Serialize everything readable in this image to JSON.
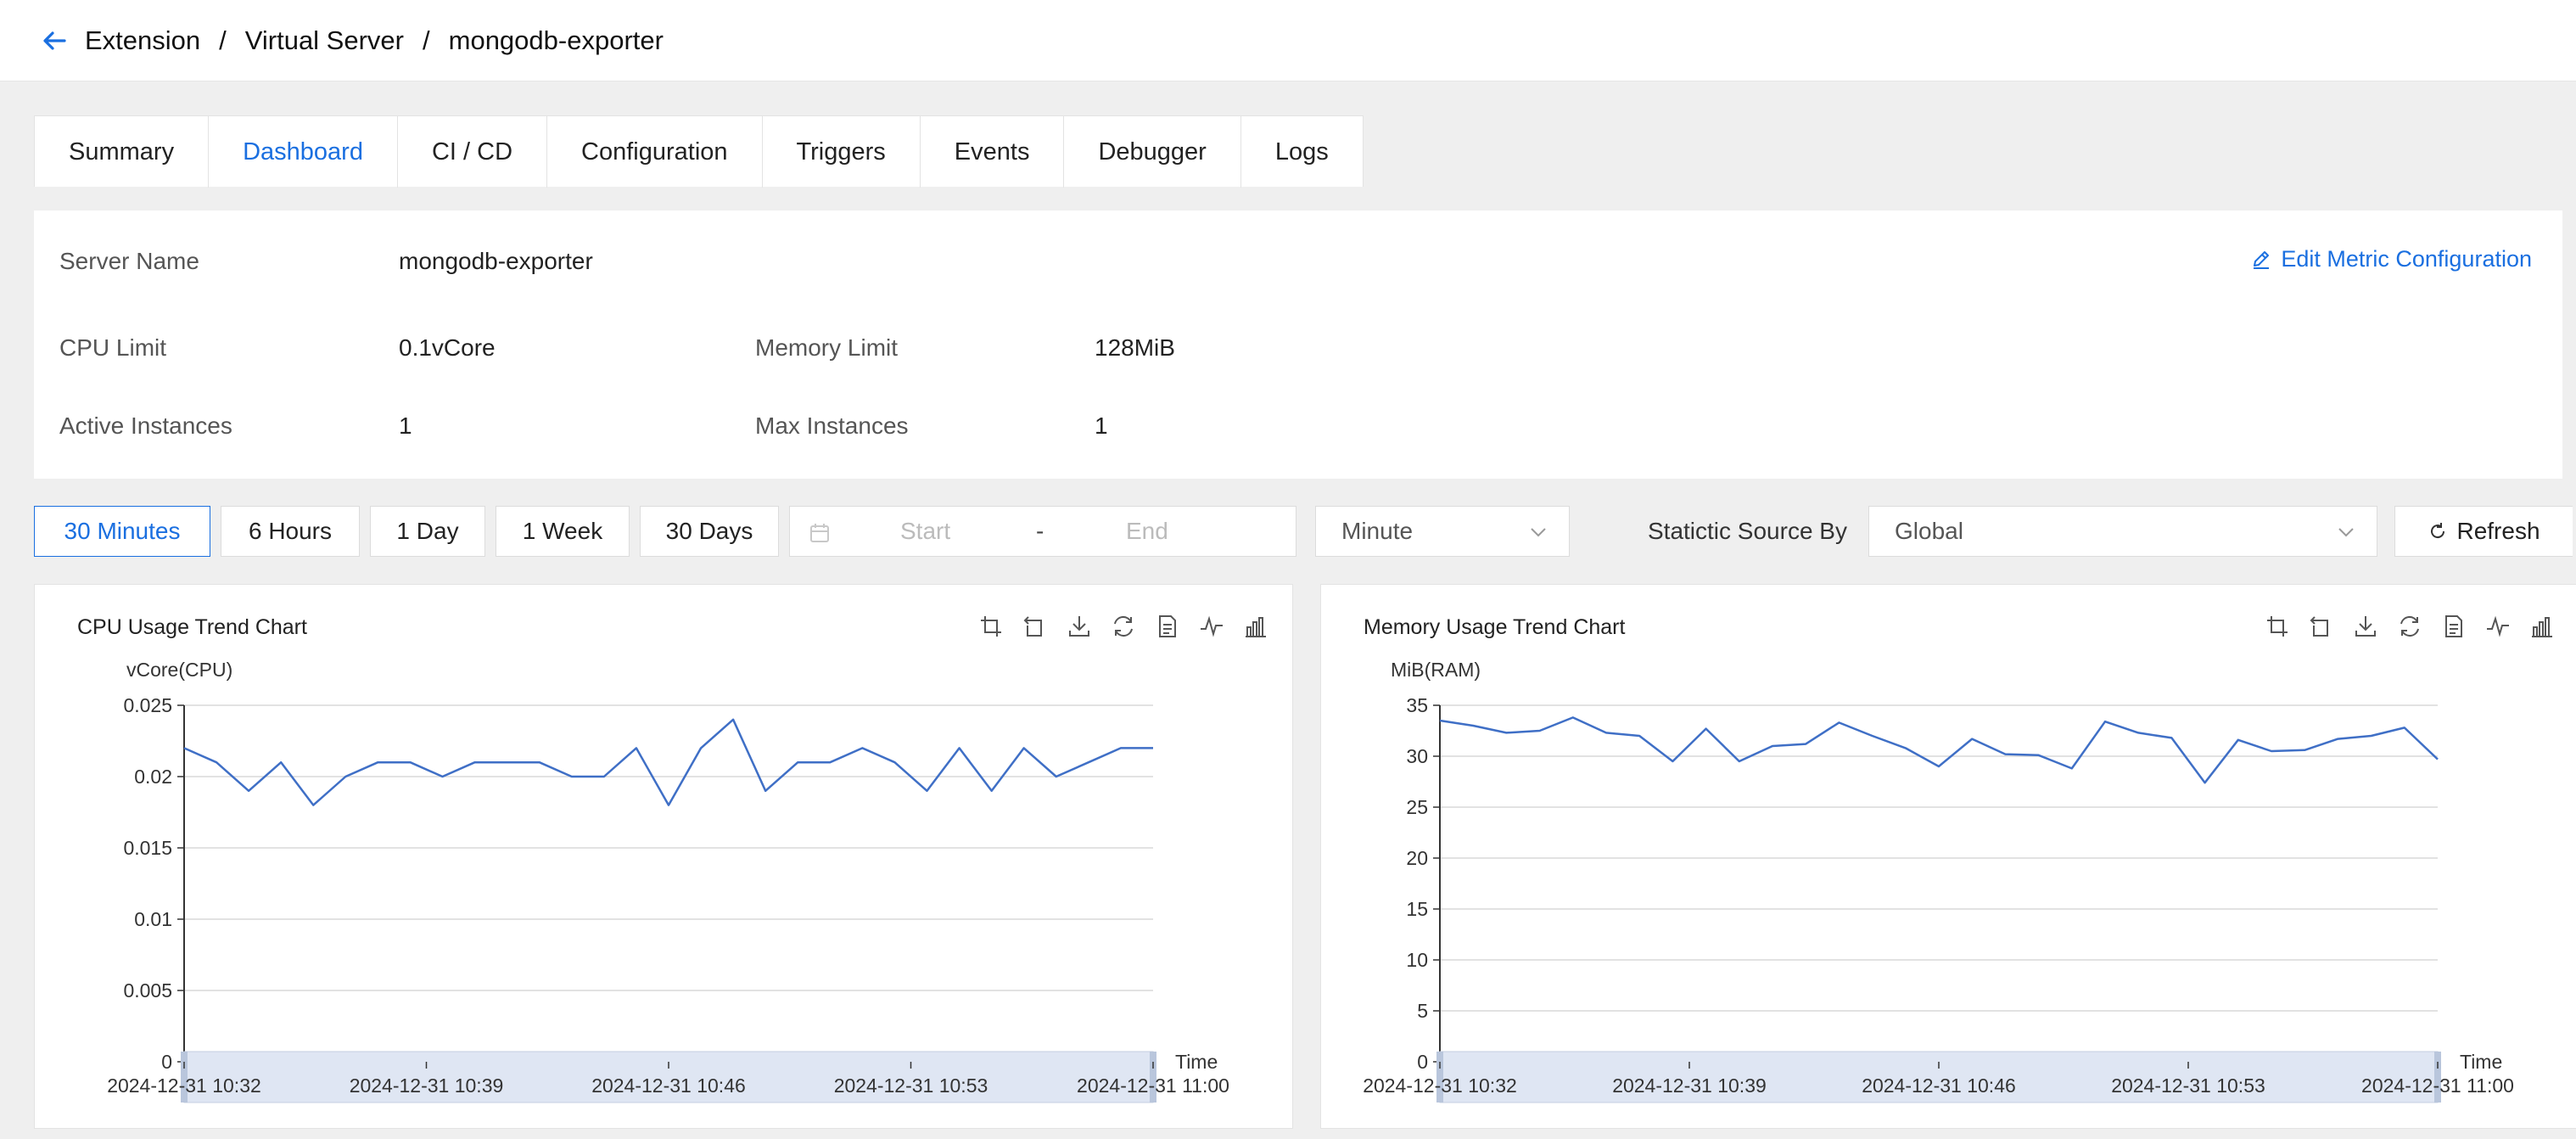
{
  "breadcrumb": {
    "items": [
      "Extension",
      "Virtual Server",
      "mongodb-exporter"
    ],
    "separator": "/"
  },
  "tabs": [
    {
      "label": "Summary",
      "active": false
    },
    {
      "label": "Dashboard",
      "active": true
    },
    {
      "label": "CI / CD",
      "active": false
    },
    {
      "label": "Configuration",
      "active": false
    },
    {
      "label": "Triggers",
      "active": false
    },
    {
      "label": "Events",
      "active": false
    },
    {
      "label": "Debugger",
      "active": false
    },
    {
      "label": "Logs",
      "active": false
    }
  ],
  "summary": {
    "server_name_label": "Server Name",
    "server_name_value": "mongodb-exporter",
    "cpu_limit_label": "CPU Limit",
    "cpu_limit_value": "0.1vCore",
    "memory_limit_label": "Memory Limit",
    "memory_limit_value": "128MiB",
    "active_instances_label": "Active Instances",
    "active_instances_value": "1",
    "max_instances_label": "Max Instances",
    "max_instances_value": "1",
    "edit_link": "Edit Metric Configuration"
  },
  "toolbar": {
    "ranges": [
      "30 Minutes",
      "6 Hours",
      "1 Day",
      "1 Week",
      "30 Days"
    ],
    "active_range": "30 Minutes",
    "start_placeholder": "Start",
    "end_placeholder": "End",
    "range_separator": "-",
    "granularity": "Minute",
    "source_label": "Statictic Source By",
    "source_value": "Global",
    "refresh_label": "Refresh"
  },
  "colors": {
    "accent": "#1a6fe0",
    "line": "#3f6fc6",
    "grid": "#d9d9d9"
  },
  "chart_data": [
    {
      "type": "line",
      "title": "CPU Usage Trend Chart",
      "ylabel": "vCore(CPU)",
      "xlabel": "Time",
      "ylim": [
        0,
        0.025
      ],
      "yticks": [
        0,
        0.005,
        0.01,
        0.015,
        0.02,
        0.025
      ],
      "ytick_labels": [
        "0",
        "0.005",
        "0.01",
        "0.015",
        "0.02",
        "0.025"
      ],
      "xtick_labels": [
        "2024-12-31 10:32",
        "2024-12-31 10:39",
        "2024-12-31 10:46",
        "2024-12-31 10:53",
        "2024-12-31 11:00"
      ],
      "series": [
        {
          "values": [
            0.022,
            0.021,
            0.019,
            0.021,
            0.018,
            0.02,
            0.021,
            0.021,
            0.02,
            0.021,
            0.021,
            0.021,
            0.02,
            0.02,
            0.022,
            0.018,
            0.022,
            0.024,
            0.019,
            0.021,
            0.021,
            0.022,
            0.021,
            0.019,
            0.022,
            0.019,
            0.022,
            0.02,
            0.021,
            0.022,
            0.022
          ]
        }
      ],
      "grid": true,
      "zoom_slider": true
    },
    {
      "type": "line",
      "title": "Memory Usage Trend Chart",
      "ylabel": "MiB(RAM)",
      "xlabel": "Time",
      "ylim": [
        0,
        35
      ],
      "yticks": [
        0,
        5,
        10,
        15,
        20,
        25,
        30,
        35
      ],
      "ytick_labels": [
        "0",
        "5",
        "10",
        "15",
        "20",
        "25",
        "30",
        "35"
      ],
      "xtick_labels": [
        "2024-12-31 10:32",
        "2024-12-31 10:39",
        "2024-12-31 10:46",
        "2024-12-31 10:53",
        "2024-12-31 11:00"
      ],
      "series": [
        {
          "values": [
            33.5,
            33.0,
            32.3,
            32.5,
            33.8,
            32.3,
            32.0,
            29.5,
            32.7,
            29.5,
            31.0,
            31.2,
            33.3,
            32.0,
            30.8,
            29.0,
            31.7,
            30.2,
            30.1,
            28.8,
            33.4,
            32.3,
            31.8,
            27.4,
            31.6,
            30.5,
            30.6,
            31.7,
            32.0,
            32.8,
            29.7
          ]
        }
      ],
      "grid": true,
      "zoom_slider": true
    }
  ]
}
